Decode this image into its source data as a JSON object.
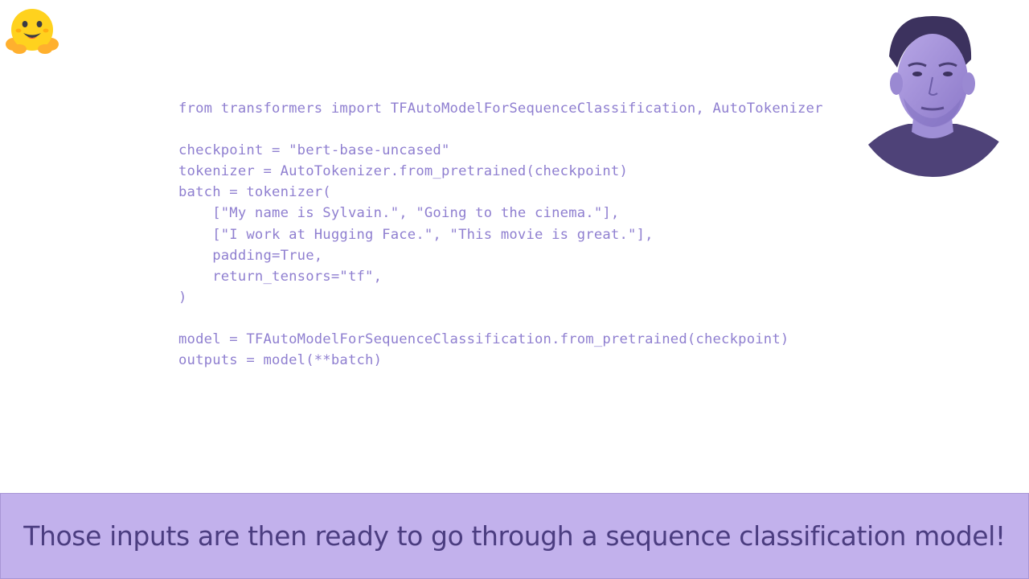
{
  "code": {
    "lines": [
      "from transformers import TFAutoModelForSequenceClassification, AutoTokenizer",
      "",
      "checkpoint = \"bert-base-uncased\"",
      "tokenizer = AutoTokenizer.from_pretrained(checkpoint)",
      "batch = tokenizer(",
      "    [\"My name is Sylvain.\", \"Going to the cinema.\"],",
      "    [\"I work at Hugging Face.\", \"This movie is great.\"],",
      "    padding=True,",
      "    return_tensors=\"tf\",",
      ")",
      "",
      "model = TFAutoModelForSequenceClassification.from_pretrained(checkpoint)",
      "outputs = model(**batch)"
    ]
  },
  "subtitle": {
    "text": "Those inputs are then ready to go through a sequence classification model!"
  },
  "icons": {
    "logo": "hugging-face-logo",
    "presenter": "presenter-webcam"
  },
  "colors": {
    "code_text": "#8f7fd0",
    "subtitle_bg": "#c2b1ec",
    "subtitle_text": "#4b3d80",
    "logo_yellow": "#FFD21E",
    "webcam_tint": "#4e4278"
  }
}
